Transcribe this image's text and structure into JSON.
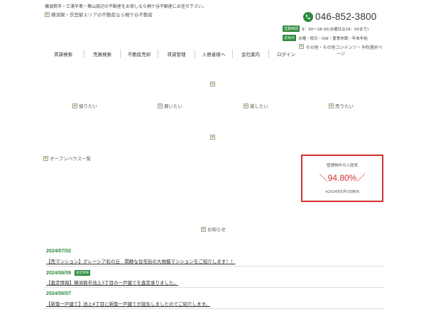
{
  "header": {
    "tagline": "横須賀市・三浦半島・葉山周辺の不動産をお探しなら桐ケ谷不動産にお任せ下さい。",
    "logo_alt": "横須賀・衣笠駅エリアの不動産なら桐ケ谷不動産",
    "phone": "046-852-3800",
    "hours_label": "営業時間",
    "hours": "9：30〜18:30(水曜日は18：00まで)",
    "closed_label": "定休日",
    "closed": "水曜・祝日・GW・夏季休暇・年末年始"
  },
  "nav": {
    "items": [
      "賃貸検索",
      "売買検索",
      "不動産売却",
      "賃貸管理",
      "入居者様へ",
      "会社案内",
      "ログイン"
    ],
    "extra": "その他・その他コンテンツ・予約選択ページ"
  },
  "categories": [
    "借りたい",
    "買いたい",
    "貸したい",
    "売りたい"
  ],
  "openhouse": "オープンハウス一覧",
  "occupancy": {
    "title": "管理物件の入居率",
    "value": "＼94.80%／",
    "date": "※2024年6月5日時点"
  },
  "news_heading": "お知らせ",
  "news": [
    {
      "date": "2024/07/02",
      "badge": "",
      "title": "【売マンション】グレーシア彩の丘　閑静な住宅街の大規模マンションをご紹介します！！"
    },
    {
      "date": "2024/06/09",
      "badge": "査定情報",
      "title": "【査定情報】横須賀市池上3丁目の一戸建てを査定承りました。"
    },
    {
      "date": "2024/06/07",
      "badge": "",
      "title": "【新築一戸建て】池上4丁目に新築一戸建てが誕生しましたのでご紹介します。"
    }
  ],
  "colors": {
    "accent": "#2e8b3d",
    "highlight": "#d32f2f"
  }
}
